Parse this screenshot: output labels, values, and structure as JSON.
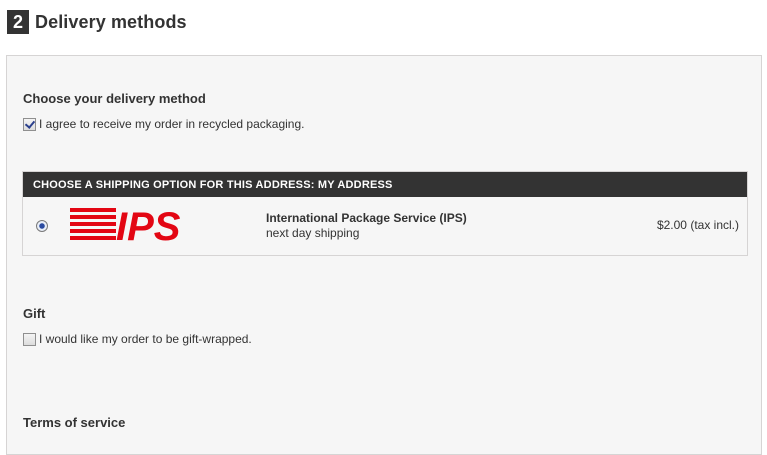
{
  "step": {
    "number": "2",
    "title": "Delivery methods"
  },
  "delivery": {
    "heading": "Choose your delivery method",
    "recycled_label": "I agree to receive my order in recycled packaging.",
    "recycled_checked": true
  },
  "shipping": {
    "header": "CHOOSE A SHIPPING OPTION FOR THIS ADDRESS: MY ADDRESS",
    "option": {
      "selected": true,
      "logo_text": "IPS",
      "logo_icon": "ips-logo-icon",
      "name": "International Package Service (IPS)",
      "delay": "next day shipping",
      "price": "$2.00 (tax incl.)"
    }
  },
  "gift": {
    "heading": "Gift",
    "label": "I would like my order to be gift-wrapped.",
    "checked": false
  },
  "terms": {
    "heading": "Terms of service"
  },
  "colors": {
    "header_bg": "#333333",
    "panel_bg": "#f6f6f6",
    "logo_red": "#e30613"
  }
}
